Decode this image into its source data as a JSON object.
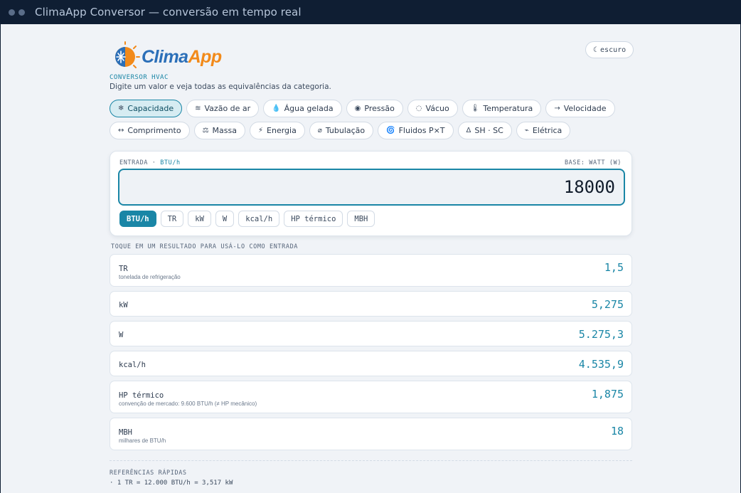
{
  "window": {
    "title": "ClimaApp Conversor — conversão em tempo real"
  },
  "header": {
    "logo_text_1": "Clima",
    "logo_text_2": "App",
    "subtitle": "CONVERSOR HVAC",
    "tagline": "Digite um valor e veja todas as equivalências da categoria.",
    "theme_toggle": {
      "icon": "☾",
      "label": "escuro"
    }
  },
  "categories": {
    "row1": [
      {
        "icon": "❄",
        "label": "Capacidade",
        "active": true
      },
      {
        "icon": "≋",
        "label": "Vazão de ar"
      },
      {
        "icon": "💧",
        "label": "Água gelada"
      },
      {
        "icon": "◉",
        "label": "Pressão"
      },
      {
        "icon": "◌",
        "label": "Vácuo"
      },
      {
        "icon": "🌡",
        "label": "Temperatura"
      },
      {
        "icon": "→",
        "label": "Velocidade"
      }
    ],
    "row2": [
      {
        "icon": "↔",
        "label": "Comprimento"
      },
      {
        "icon": "⚖",
        "label": "Massa"
      },
      {
        "icon": "⚡",
        "label": "Energia"
      },
      {
        "icon": "⌀",
        "label": "Tubulação"
      },
      {
        "icon": "🌀",
        "label": "Fluidos P×T"
      },
      {
        "icon": "Δ",
        "label": "SH · SC"
      },
      {
        "icon": "⌁",
        "label": "Elétrica"
      }
    ]
  },
  "input": {
    "label": "ENTRADA ·",
    "unit": "BTU/h",
    "base": "BASE: WATT (W)",
    "value": "18000",
    "units": [
      "BTU/h",
      "TR",
      "kW",
      "W",
      "kcal/h",
      "HP térmico",
      "MBH"
    ],
    "active_unit": "BTU/h"
  },
  "hint": "TOQUE EM UM RESULTADO PARA USÁ-LO COMO ENTRADA",
  "results": [
    {
      "unit": "TR",
      "desc": "tonelada de refrigeração",
      "value": "1,5"
    },
    {
      "unit": "kW",
      "desc": "",
      "value": "5,275"
    },
    {
      "unit": "W",
      "desc": "",
      "value": "5.275,3"
    },
    {
      "unit": "kcal/h",
      "desc": "",
      "value": "4.535,9"
    },
    {
      "unit": "HP térmico",
      "desc": "convenção de mercado: 9.600 BTU/h (≠ HP mecânico)",
      "value": "1,875"
    },
    {
      "unit": "MBH",
      "desc": "milhares de BTU/h",
      "value": "18"
    }
  ],
  "references": {
    "title": "REFERÊNCIAS RÁPIDAS",
    "lines": [
      "· 1 TR = 12.000 BTU/h = 3,517 kW"
    ]
  },
  "colors": {
    "accent": "#1a86a6",
    "logo_blue": "#2b6fb8",
    "logo_orange": "#f28a1a",
    "titlebar": "#0f1e33",
    "background": "#f0f3f7"
  }
}
